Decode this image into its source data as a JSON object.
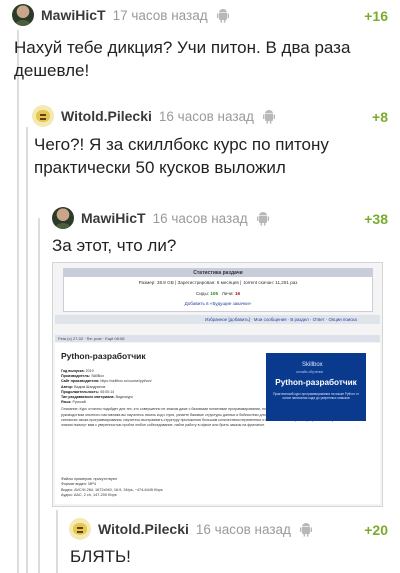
{
  "comments": [
    {
      "author": "MawiHicT",
      "time": "17 часов назад",
      "rating": "+16",
      "text_lines": [
        "Нахуй тебе дикция? Учи питон. В два раза",
        "дешевле!"
      ]
    },
    {
      "author": "Witold.Pilecki",
      "time": "16 часов назад",
      "rating": "+8",
      "text_lines": [
        "Чего?! Я за скиллбокс курс по питону",
        "практически 50 кусков выложил"
      ]
    },
    {
      "author": "MawiHicT",
      "time": "16 часов назад",
      "rating": "+38",
      "text_lines": [
        "За этот, что ли?"
      ]
    },
    {
      "author": "Witold.Pilecki",
      "time": "16 часов назад",
      "rating": "+20",
      "text_lines": [
        "БЛЯТЬ!"
      ]
    }
  ],
  "embedded_screenshot": {
    "stats_title": "Статистика раздачи",
    "stats_row": "Размер: 38.8 GB | Зарегистрирован: 6 месяцев | .torrent скачан: 11,261 раз",
    "seeds_label": "Сиды:",
    "seeds_value": "105",
    "leech_label": "Личи:",
    "leech_value": "16",
    "add_fav": "Добавить в «Будущие закачки»",
    "bar_text": "Избранное [добавить] · Мои сообщения · В раздел · Ответ · Опции поиска",
    "post_meta": "Feta (с) 27-02 · Re: post · Ещё 08:08",
    "post_title": "Python-разработчик",
    "details": [
      {
        "k": "Год выпуска:",
        "v": "2019"
      },
      {
        "k": "Производитель:",
        "v": "SkillBox"
      },
      {
        "k": "Сайт производителя:",
        "v": "https://skillbox.ru/course/python/"
      },
      {
        "k": "Автор:",
        "v": "Вадим Шандринов"
      },
      {
        "k": "Продолжительность:",
        "v": "05:00:14"
      },
      {
        "k": "Тип раздаваемого материала:",
        "v": "Видеокурс"
      },
      {
        "k": "Язык:",
        "v": "Русский"
      }
    ],
    "description": "Описание: Курс отлично подойдет для тех, кто совершенно не знаком даже с базовыми понятиями программирования, но хотел бы начать развиваться в IT-индустрии. Под руководством опытного наставника вы научитесь писать код с нуля, узнаете базовые структуры данных и библиотеки для работы с ними. Вы подробно изучите основы языка и синтаксис языка программирования, научитесь выстраивать структуру приложения большим количеством переменных и напишете свои первые программы на Python. Эти знания помогут вам с уверенностью пройти любое собеседование, найти работу в офисе или брать заказы на фрилансе.",
    "cover_brand": "Skillbox",
    "cover_brand_sub": "онлайн-обучение",
    "cover_title": "Python-разработчик",
    "cover_desc": "Практический курс программирования на языке Python от основ написания кода до уверенных навыков",
    "specs": [
      "Файлы примеров: присутствуют",
      "Формат видео: MP4",
      "Видео: AVC/H.264, 1672x940, 16:9, 24fps, ~474-6445 Kbps",
      "Аудио: AAC, 2 ch, 147-200 Kbps"
    ]
  },
  "colors": {
    "rating": "#7bab2d",
    "time": "#9a9a9a",
    "branch": "#dcdcdc"
  },
  "icons": [
    "android-icon"
  ]
}
